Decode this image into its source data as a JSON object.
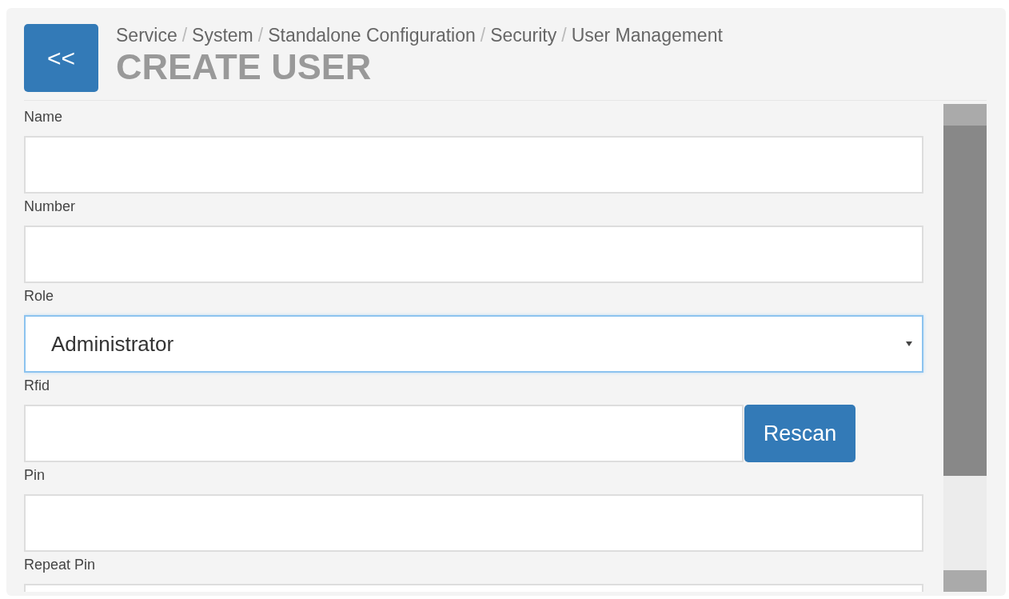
{
  "header": {
    "back_button": "<<",
    "breadcrumb_separator": "/",
    "breadcrumb": [
      "Service",
      "System",
      "Standalone Configuration",
      "Security",
      "User Management"
    ],
    "title": "CREATE USER"
  },
  "fields": [
    {
      "label": "Name",
      "kind": "text",
      "focused": false
    },
    {
      "label": "Number",
      "kind": "text",
      "focused": false
    },
    {
      "label": "Role",
      "kind": "select",
      "value": "Administrator",
      "focused": true
    },
    {
      "label": "Rfid",
      "kind": "text_with_button",
      "button": "Rescan",
      "focused": false
    },
    {
      "label": "Pin",
      "kind": "text",
      "focused": false
    },
    {
      "label": "Repeat Pin",
      "kind": "text",
      "focused": false
    }
  ]
}
